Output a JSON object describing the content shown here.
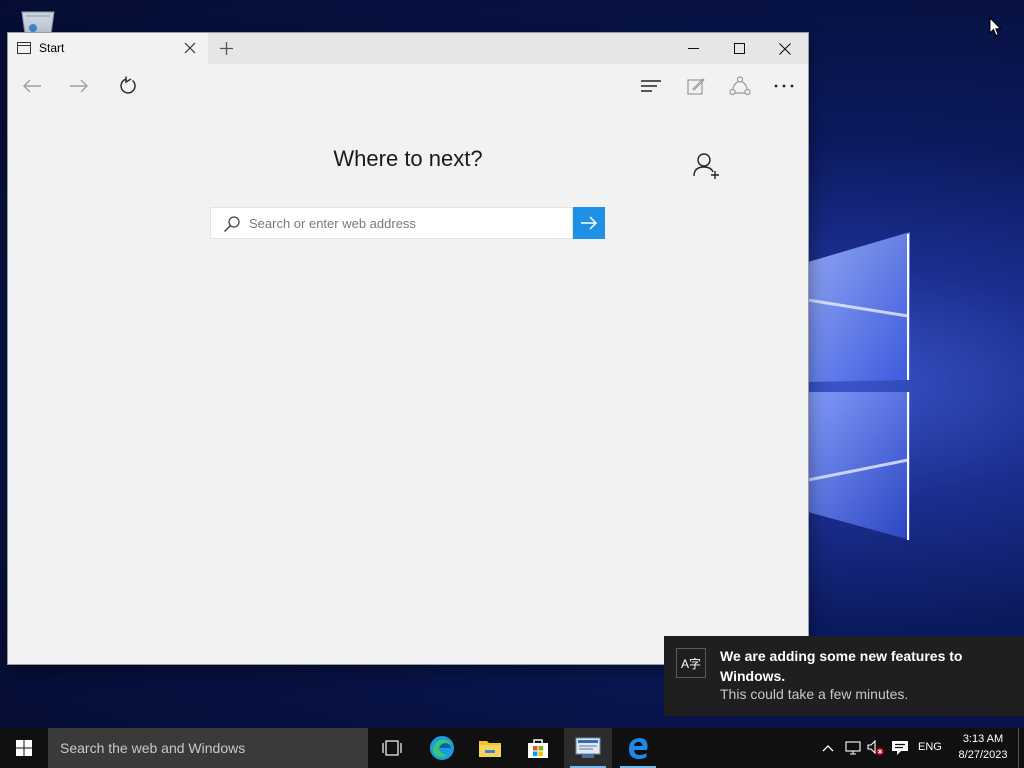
{
  "browser": {
    "tab_title": "Start",
    "heading": "Where to next?",
    "search_placeholder": "Search or enter web address",
    "accent_color": "#1e90e6"
  },
  "notification": {
    "icon_text": "A字",
    "title": "We are adding some new features to Windows.",
    "body": "This could take a few minutes."
  },
  "taskbar": {
    "search_text": "Search the web and Windows",
    "pinned_apps": [
      "task-view",
      "edge-chromium",
      "file-explorer",
      "store",
      "server-manager",
      "edge-legacy"
    ],
    "language": "ENG",
    "time": "3:13 AM",
    "date": "8/27/2023"
  }
}
